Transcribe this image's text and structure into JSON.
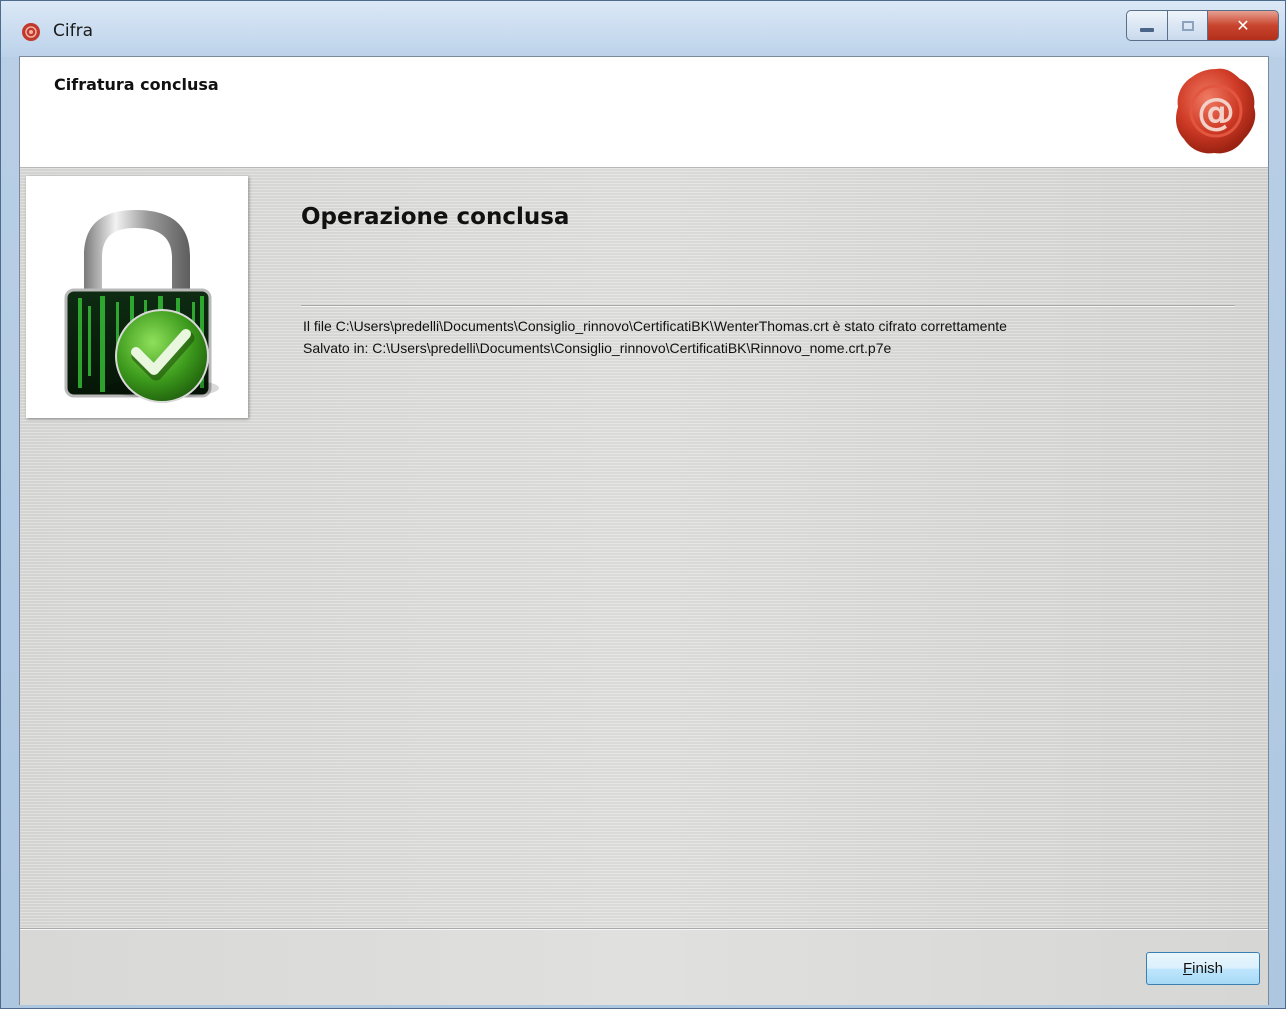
{
  "window": {
    "title": "Cifra"
  },
  "header": {
    "title": "Cifratura conclusa",
    "logo_icon": "seal-at-icon"
  },
  "main": {
    "title": "Operazione conclusa",
    "message_line1": "Il file C:\\Users\\predelli\\Documents\\Consiglio_rinnovo\\CertificatiBK\\WenterThomas.crt è stato cifrato correttamente",
    "message_line2": "Salvato in: C:\\Users\\predelli\\Documents\\Consiglio_rinnovo\\CertificatiBK\\Rinnovo_nome.crt.p7e",
    "side_icon": "padlock-check-icon"
  },
  "footer": {
    "finish_accel": "F",
    "finish_rest": "inish"
  },
  "colors": {
    "seal_red": "#c0392b",
    "check_green": "#3c9a1c",
    "close_red": "#c8442d"
  }
}
